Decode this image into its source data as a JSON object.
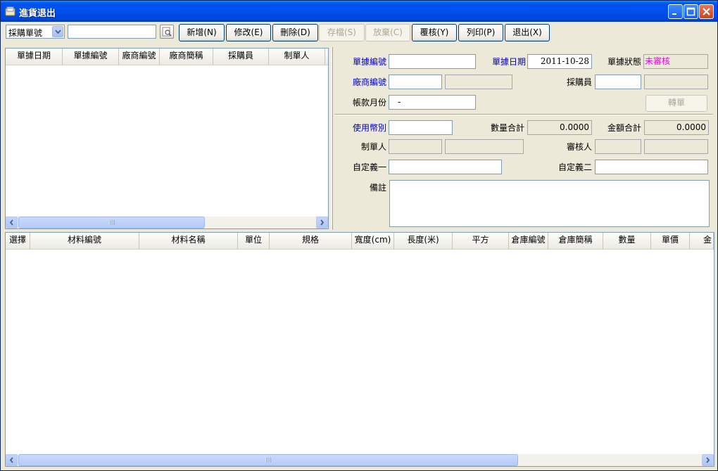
{
  "window": {
    "title": "進貨退出"
  },
  "toolbar": {
    "search_field_selected": "採購單號",
    "search_value": "",
    "buttons": {
      "new": "新增(N)",
      "edit": "修改(E)",
      "delete": "刪除(D)",
      "save": "存檔(S)",
      "discard": "放棄(C)",
      "review": "覆核(Y)",
      "print": "列印(P)",
      "exit": "退出(X)"
    }
  },
  "left_grid": {
    "columns": [
      "單據日期",
      "單據編號",
      "廠商編號",
      "廠商簡稱",
      "採購員",
      "制單人"
    ],
    "rows": []
  },
  "form": {
    "doc_no_label": "單據編號",
    "doc_no": "",
    "doc_date_label": "單據日期",
    "doc_date": "2011-10-28",
    "doc_status_label": "單據狀態",
    "doc_status": "未審核",
    "vendor_no_label": "廠商編號",
    "vendor_no": "",
    "vendor_name": "",
    "buyer_label": "採購員",
    "buyer": "",
    "buyer_name": "",
    "account_month_label": "帳款月份",
    "account_month": "-",
    "transfer_label": "轉單",
    "currency_label": "使用幣別",
    "currency": "",
    "qty_total_label": "數量合計",
    "qty_total": "0.0000",
    "amount_total_label": "金額合計",
    "amount_total": "0.0000",
    "maker_label": "制單人",
    "maker": "",
    "maker_name": "",
    "reviewer_label": "審核人",
    "reviewer": "",
    "reviewer_name": "",
    "custom1_label": "自定義一",
    "custom1": "",
    "custom2_label": "自定義二",
    "custom2": "",
    "memo_label": "備註",
    "memo": ""
  },
  "bottom_grid": {
    "columns": [
      "選擇",
      "材料編號",
      "材料名稱",
      "單位",
      "規格",
      "寬度(cm)",
      "長度(米)",
      "平方",
      "倉庫編號",
      "倉庫簡稱",
      "數量",
      "單價",
      "金"
    ],
    "rows": []
  },
  "colors": {
    "title_bar": "#0053ee",
    "required_label": "#0000c8",
    "status_text": "#ee00ee",
    "face": "#ece9d8"
  }
}
